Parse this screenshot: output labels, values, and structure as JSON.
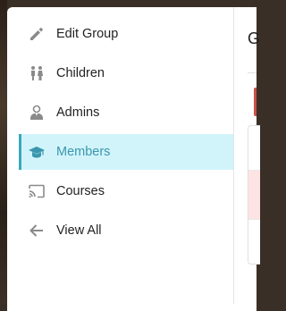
{
  "sidebar": {
    "items": [
      {
        "label": "Edit Group",
        "icon": "pencil-icon",
        "active": false
      },
      {
        "label": "Children",
        "icon": "children-icon",
        "active": false
      },
      {
        "label": "Admins",
        "icon": "admin-user-icon",
        "active": false
      },
      {
        "label": "Members",
        "icon": "graduation-cap-icon",
        "active": true
      },
      {
        "label": "Courses",
        "icon": "cast-icon",
        "active": false
      },
      {
        "label": "View All",
        "icon": "arrow-left-icon",
        "active": false
      }
    ]
  },
  "main": {
    "heading": "G"
  },
  "colors": {
    "active_bg": "#d1f4fb",
    "active_accent": "#39a8bd",
    "icon_gray": "#8a8a8a",
    "alert_red": "#c9524a",
    "row_pink": "#fde3e3"
  }
}
